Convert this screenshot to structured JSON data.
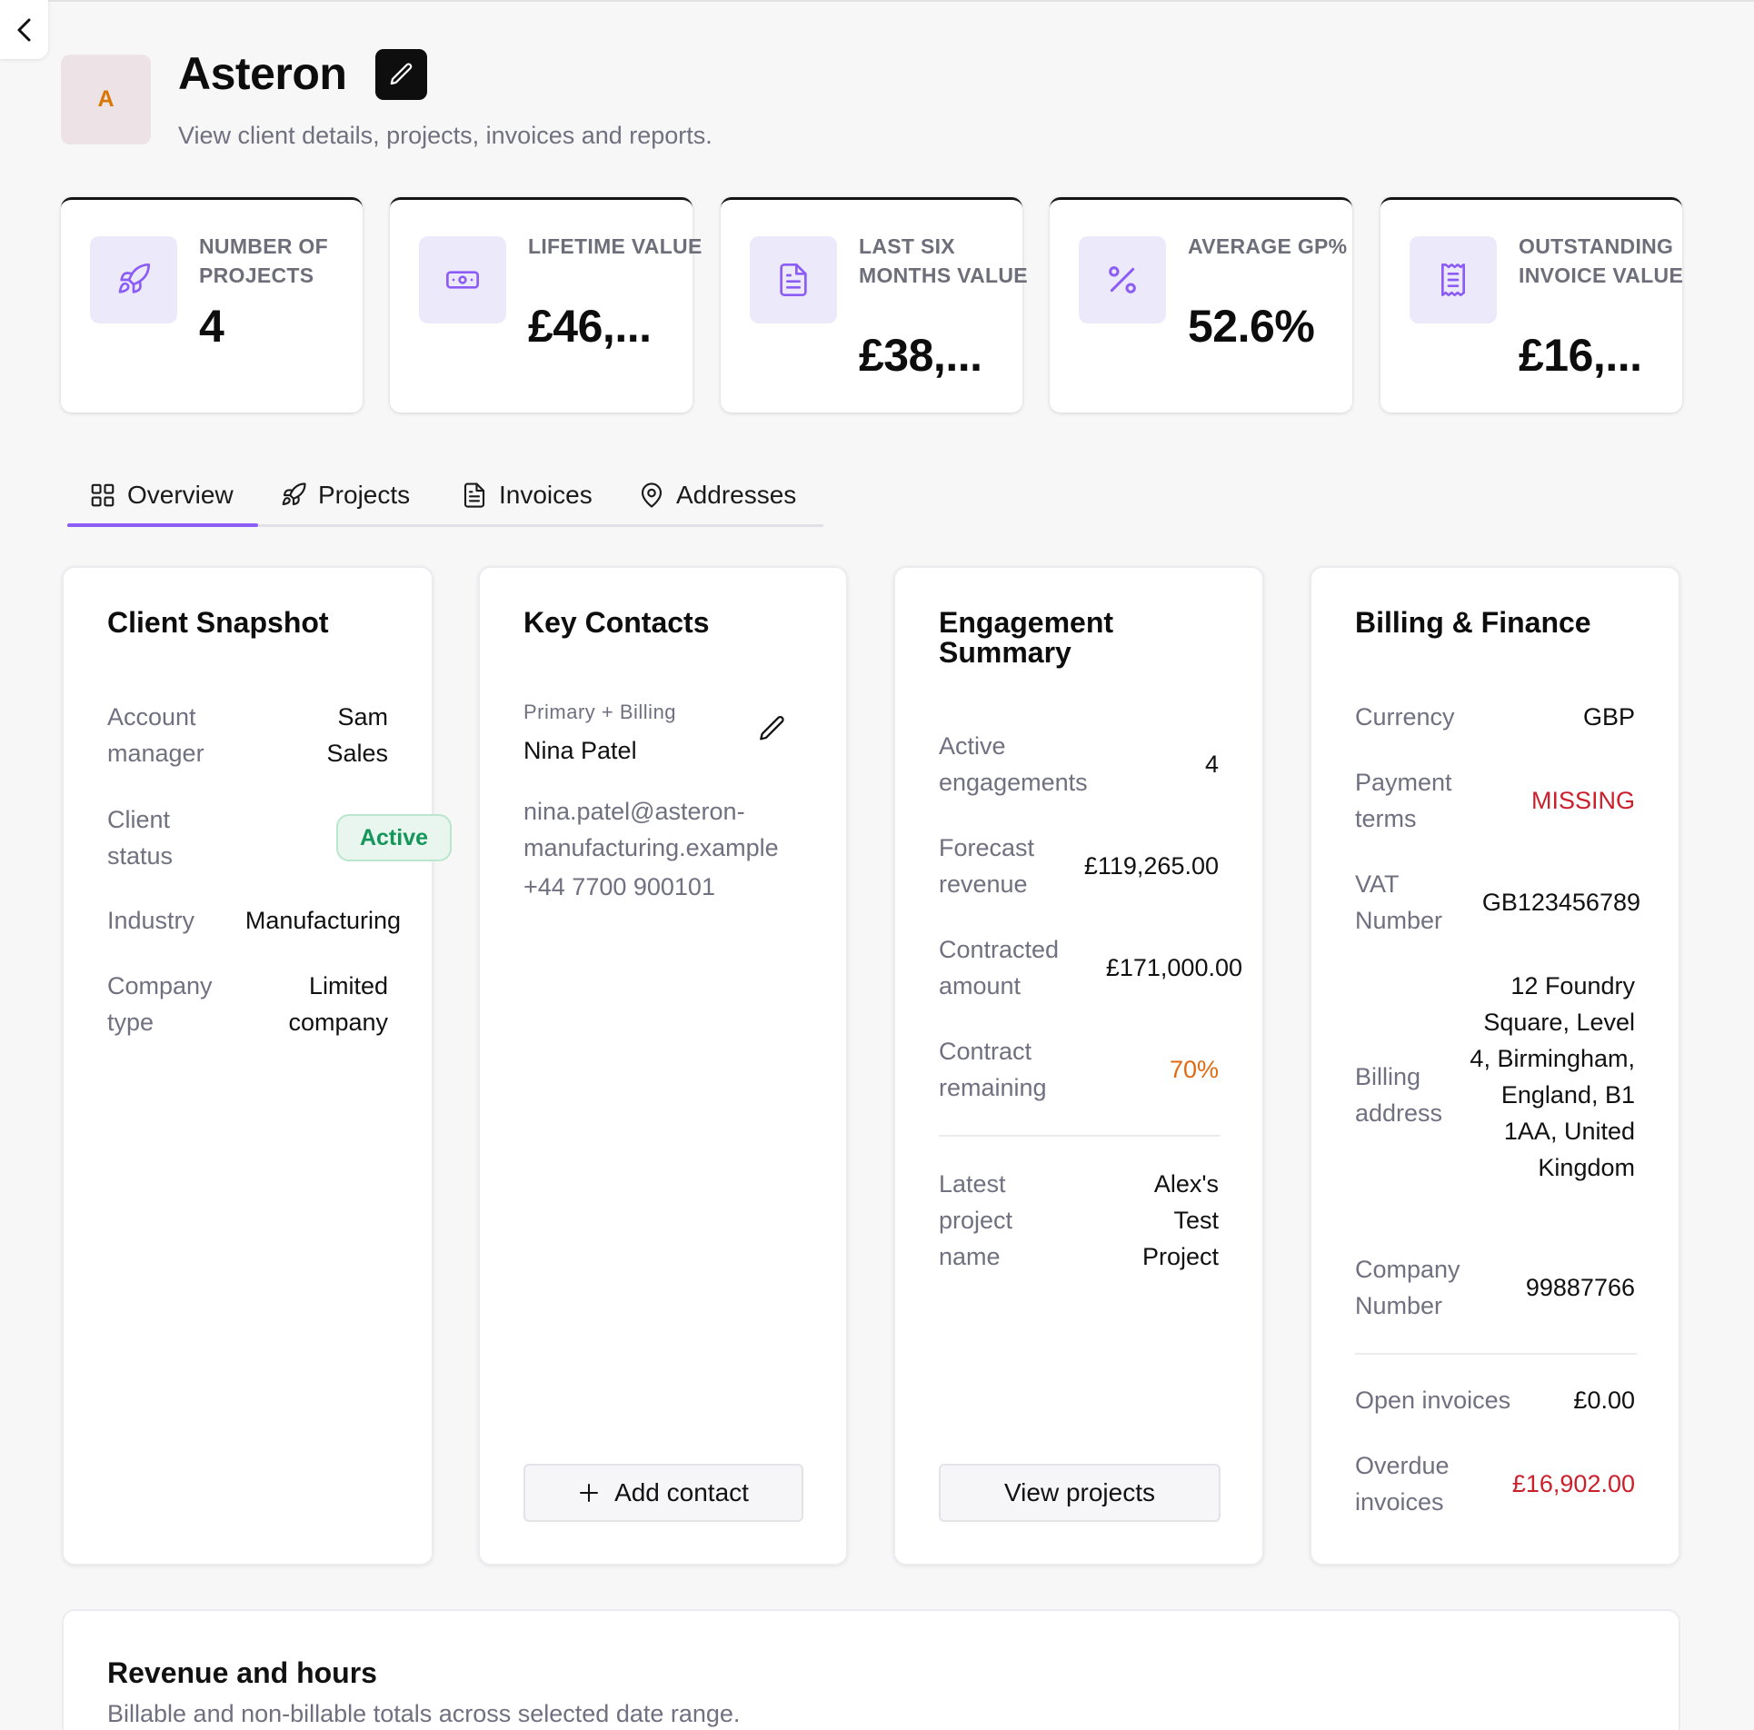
{
  "header": {
    "avatar_letter": "A",
    "title": "Asteron",
    "subtitle": "View client details, projects, invoices and reports."
  },
  "stats": [
    {
      "label": "NUMBER OF PROJECTS",
      "value": "4",
      "icon": "rocket-icon"
    },
    {
      "label": "LIFETIME VALUE",
      "value": "£46,...",
      "icon": "banknote-icon"
    },
    {
      "label": "LAST SIX MONTHS VALUE",
      "value": "£38,...",
      "icon": "document-icon"
    },
    {
      "label": "AVERAGE GP%",
      "value": "52.6%",
      "icon": "percent-icon"
    },
    {
      "label": "OUTSTANDING INVOICE VALUE",
      "value": "£16,...",
      "icon": "receipt-icon"
    }
  ],
  "tabs": [
    {
      "label": "Overview",
      "icon": "grid-icon",
      "active": true
    },
    {
      "label": "Projects",
      "icon": "rocket-icon",
      "active": false
    },
    {
      "label": "Invoices",
      "icon": "document-icon",
      "active": false
    },
    {
      "label": "Addresses",
      "icon": "map-pin-icon",
      "active": false
    }
  ],
  "snapshot": {
    "title": "Client Snapshot",
    "account_manager_label": "Account manager",
    "account_manager_value": "Sam Sales",
    "client_status_label": "Client status",
    "client_status_value": "Active",
    "industry_label": "Industry",
    "industry_value": "Manufacturing",
    "company_type_label": "Company type",
    "company_type_value": "Limited company"
  },
  "contacts": {
    "title": "Key Contacts",
    "role": "Primary + Billing",
    "name": "Nina Patel",
    "email": "nina.patel@asteron-manufacturing.example",
    "phone": "+44 7700 900101",
    "add_label": "Add contact"
  },
  "engagement": {
    "title": "Engagement Summary",
    "active_label": "Active engagements",
    "active_value": "4",
    "forecast_label": "Forecast revenue",
    "forecast_value": "£119,265.00",
    "contracted_label": "Contracted amount",
    "contracted_value": "£171,000.00",
    "remaining_label": "Contract remaining",
    "remaining_value": "70%",
    "latest_label": "Latest project name",
    "latest_value": "Alex's Test Project",
    "button_label": "View projects"
  },
  "billing": {
    "title": "Billing & Finance",
    "currency_label": "Currency",
    "currency_value": "GBP",
    "terms_label": "Payment terms",
    "terms_value": "MISSING",
    "vat_label": "VAT Number",
    "vat_value": "GB123456789",
    "address_label": "Billing address",
    "address_value": "12 Foundry Square, Level 4, Birmingham, England, B1 1AA, United Kingdom",
    "company_number_label": "Company Number",
    "company_number_value": "99887766",
    "open_label": "Open invoices",
    "open_value": "£0.00",
    "overdue_label": "Overdue invoices",
    "overdue_value": "£16,902.00"
  },
  "revenue": {
    "title": "Revenue and hours",
    "subtitle": "Billable and non-billable totals across selected date range."
  },
  "colors": {
    "accent": "#8b5cf6",
    "icon_tile": "#ece9fb",
    "status_green": "#14965a",
    "warning_orange": "#e06a12",
    "danger_red": "#cc1f2c"
  }
}
